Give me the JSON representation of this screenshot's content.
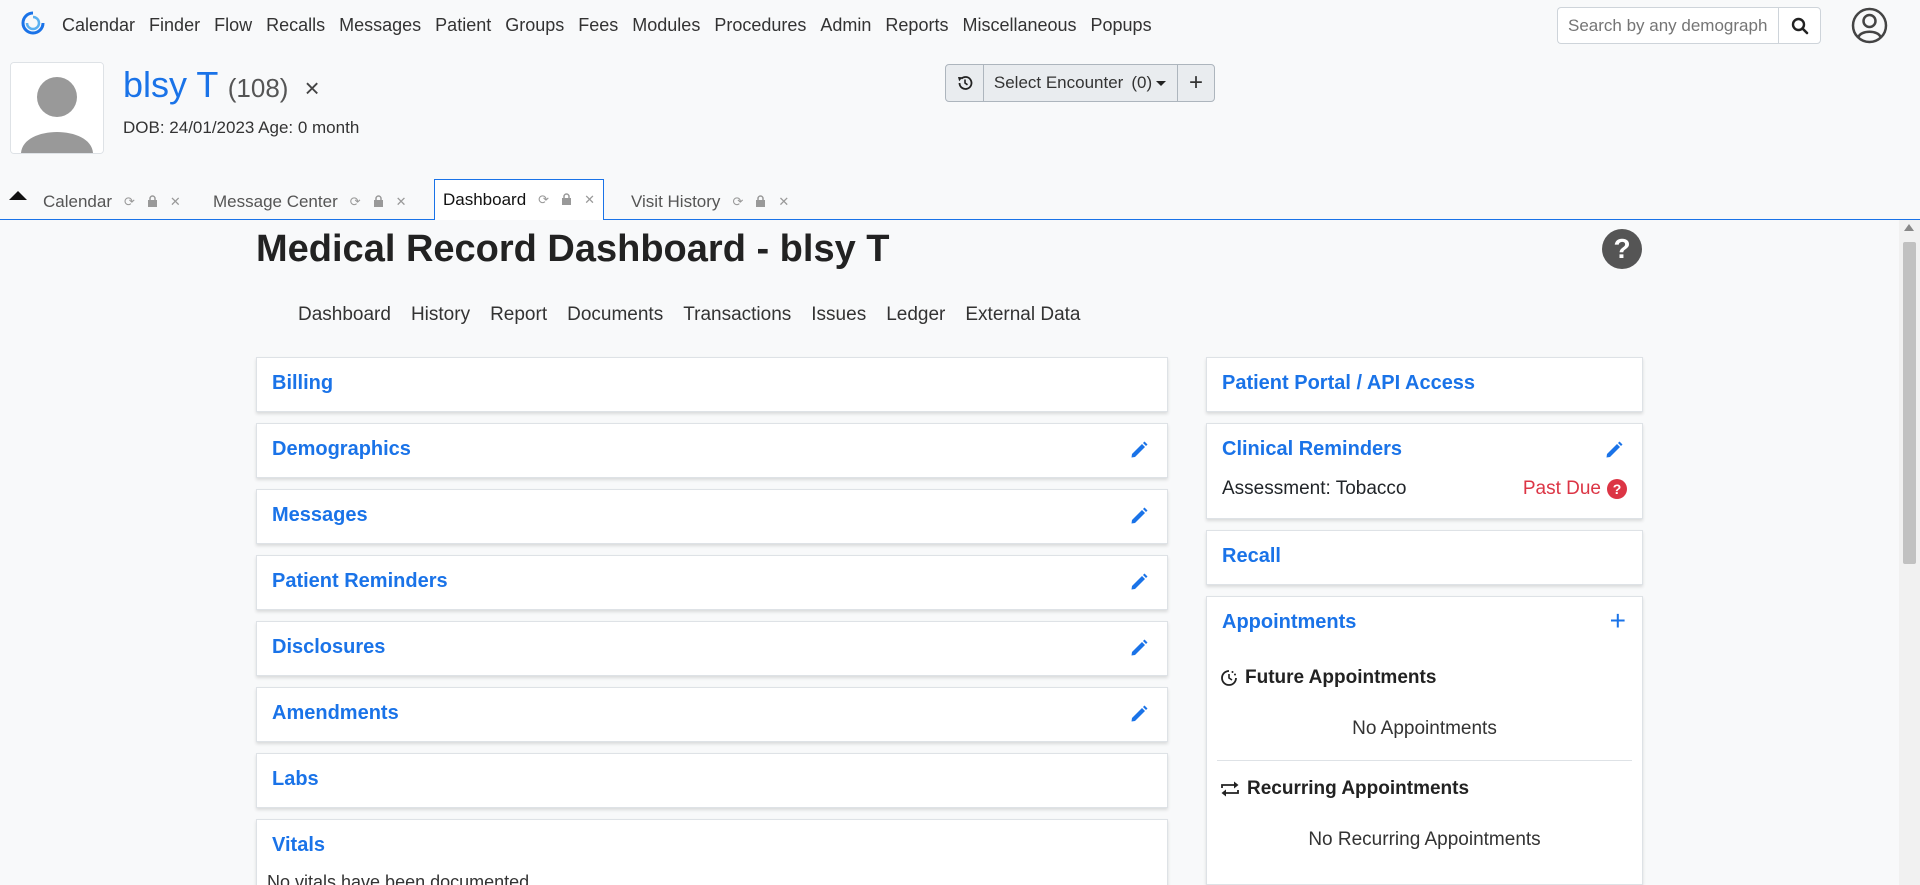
{
  "nav": {
    "items": [
      "Calendar",
      "Finder",
      "Flow",
      "Recalls",
      "Messages",
      "Patient",
      "Groups",
      "Fees",
      "Modules",
      "Procedures",
      "Admin",
      "Reports",
      "Miscellaneous",
      "Popups"
    ],
    "search_placeholder": "Search by any demographics"
  },
  "patient": {
    "name": "blsy T",
    "pid": "(108)",
    "close": "×",
    "dob_line": "DOB: 24/01/2023 Age: 0 month"
  },
  "encounter": {
    "select_label": "Select Encounter",
    "count": "(0)",
    "add": "+"
  },
  "tabs": [
    {
      "label": "Calendar"
    },
    {
      "label": "Message Center"
    },
    {
      "label": "Dashboard"
    },
    {
      "label": "Visit History"
    }
  ],
  "main": {
    "title": "Medical Record Dashboard - blsy T",
    "help": "?",
    "subnav": [
      "Dashboard",
      "History",
      "Report",
      "Documents",
      "Transactions",
      "Issues",
      "Ledger",
      "External Data"
    ]
  },
  "left_cards": {
    "billing": "Billing",
    "demographics": "Demographics",
    "messages": "Messages",
    "patient_reminders": "Patient Reminders",
    "disclosures": "Disclosures",
    "amendments": "Amendments",
    "labs": "Labs",
    "vitals": "Vitals",
    "vitals_note": "No vitals have been documented."
  },
  "right_cards": {
    "portal": "Patient Portal / API Access",
    "clinical_reminders": "Clinical Reminders",
    "reminder_item": "Assessment: Tobacco",
    "reminder_status": "Past Due",
    "reminder_status_badge": "?",
    "recall": "Recall",
    "appointments": "Appointments",
    "appointments_add": "+",
    "future_title": "Future Appointments",
    "future_none": "No Appointments",
    "recurring_title": "Recurring Appointments",
    "recurring_none": "No Recurring Appointments"
  },
  "colors": {
    "accent": "#1a73e8",
    "danger": "#dc3545"
  }
}
